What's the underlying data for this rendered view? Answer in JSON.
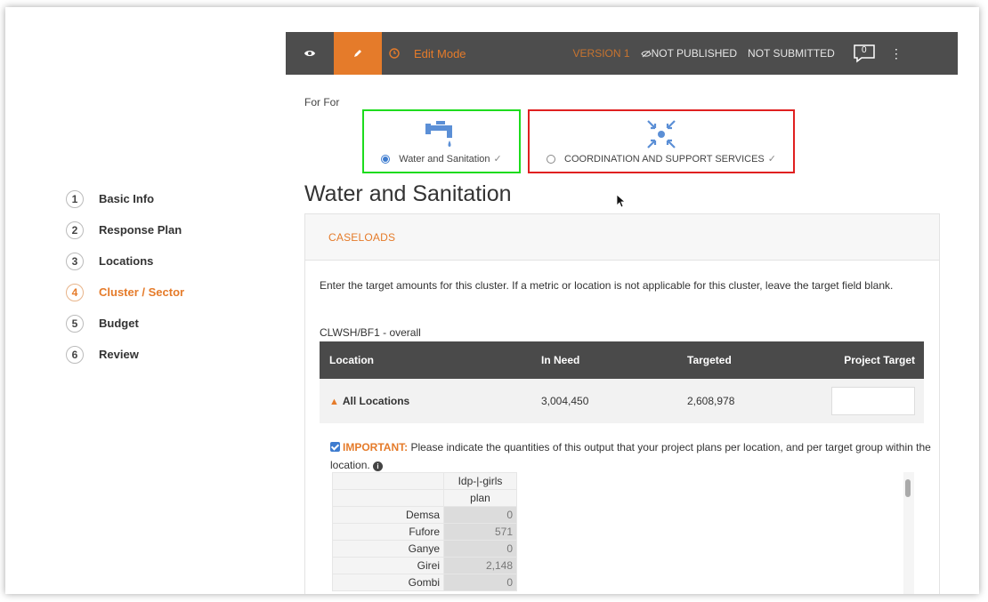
{
  "sidebar": {
    "steps": [
      {
        "num": "1",
        "label": "Basic Info"
      },
      {
        "num": "2",
        "label": "Response Plan"
      },
      {
        "num": "3",
        "label": "Locations"
      },
      {
        "num": "4",
        "label": "Cluster / Sector"
      },
      {
        "num": "5",
        "label": "Budget"
      },
      {
        "num": "6",
        "label": "Review"
      }
    ],
    "active_step": "4"
  },
  "toolbar": {
    "mode_label": "Edit Mode",
    "version": "VERSION 1",
    "published_status": "NOT PUBLISHED",
    "submitted_status": "NOT SUBMITTED",
    "comment_count": "0"
  },
  "cluster_select": {
    "for_label": "For For",
    "options": [
      {
        "label": "Water and Sanitation",
        "selected": true,
        "icon": "water-tap-icon"
      },
      {
        "label": "COORDINATION AND SUPPORT SERVICES",
        "selected": false,
        "icon": "coordination-arrows-icon"
      }
    ]
  },
  "page_title": "Water and Sanitation",
  "panel": {
    "header": "CASELOADS",
    "intro": "Enter the target amounts for this cluster. If a metric or location is not applicable for this cluster, leave the target field blank.",
    "metric": "CLWSH/BF1 - overall",
    "table": {
      "headers": [
        "Location",
        "In Need",
        "Targeted",
        "Project Target"
      ],
      "row": {
        "location": "All Locations",
        "in_need": "3,004,450",
        "targeted": "2,608,978",
        "project_target": ""
      }
    },
    "important": {
      "prefix": "IMPORTANT:",
      "text": "Please indicate the quantities of this output that your project plans per location, and per target group within the location."
    },
    "grid": {
      "group_header": "Idp-|-girls",
      "sub_header": "plan",
      "rows": [
        {
          "name": "Demsa",
          "value": "0"
        },
        {
          "name": "Fufore",
          "value": "571"
        },
        {
          "name": "Ganye",
          "value": "0"
        },
        {
          "name": "Girei",
          "value": "2,148"
        },
        {
          "name": "Gombi",
          "value": "0"
        }
      ]
    }
  },
  "colors": {
    "accent": "#e57b2a",
    "toolbar": "#4d4d4d",
    "radio": "#3e7ccf",
    "highlight_green": "#1ddc1d",
    "highlight_red": "#e02020"
  }
}
